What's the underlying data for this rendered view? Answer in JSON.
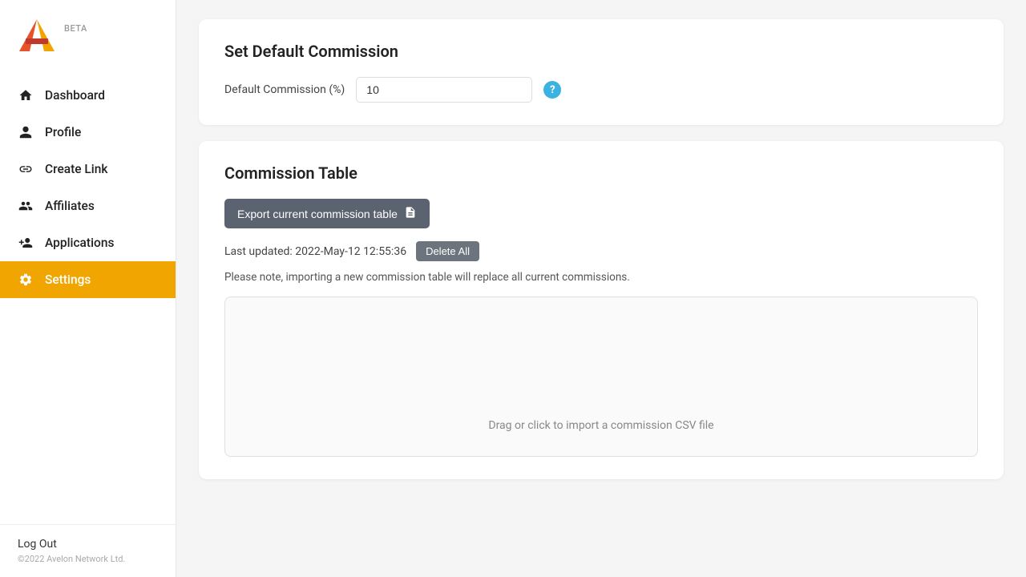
{
  "sidebar": {
    "beta_label": "BETA",
    "nav_items": [
      {
        "id": "dashboard",
        "label": "Dashboard",
        "icon": "home"
      },
      {
        "id": "profile",
        "label": "Profile",
        "icon": "user"
      },
      {
        "id": "create-link",
        "label": "Create Link",
        "icon": "link"
      },
      {
        "id": "affiliates",
        "label": "Affiliates",
        "icon": "users"
      },
      {
        "id": "applications",
        "label": "Applications",
        "icon": "user-plus"
      },
      {
        "id": "settings",
        "label": "Settings",
        "icon": "gear",
        "active": true
      }
    ],
    "logout_label": "Log Out",
    "copyright": "©2022 Avelon Network Ltd."
  },
  "main": {
    "commission_card": {
      "title": "Set Default Commission",
      "form_label": "Default Commission (%)",
      "form_value": "10",
      "help_icon": "?"
    },
    "table_card": {
      "title": "Commission Table",
      "export_btn_label": "Export current commission table",
      "last_updated_label": "Last updated: 2022-May-12 12:55:36",
      "delete_all_label": "Delete All",
      "import_note": "Please note, importing a new commission table will replace all current commissions.",
      "dropzone_text": "Drag or click to import a commission CSV file"
    }
  }
}
